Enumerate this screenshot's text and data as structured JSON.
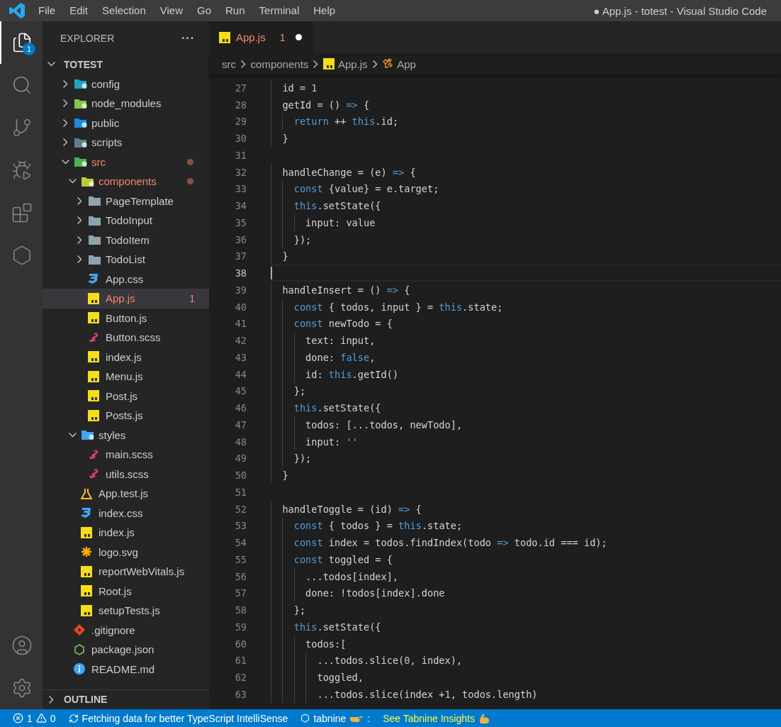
{
  "title_bar": {
    "menu": [
      "File",
      "Edit",
      "Selection",
      "View",
      "Go",
      "Run",
      "Terminal",
      "Help"
    ],
    "title": "● App.js - totest - Visual Studio Code"
  },
  "activity_bar": {
    "items": [
      {
        "kind": "explorer",
        "selected": true,
        "badge": "1"
      },
      {
        "kind": "search",
        "selected": false
      },
      {
        "kind": "source-control",
        "selected": false
      },
      {
        "kind": "run",
        "selected": false
      },
      {
        "kind": "extensions",
        "selected": false
      },
      {
        "kind": "remote",
        "selected": false
      }
    ],
    "bottom": [
      {
        "kind": "account"
      },
      {
        "kind": "settings"
      }
    ]
  },
  "sidebar": {
    "title": "EXPLORER",
    "more": "···",
    "section": {
      "title": "TOTEST",
      "expanded": true
    },
    "tree": [
      {
        "name": "config",
        "kind": "folder-config",
        "expanded": false,
        "selected": false,
        "problem": false
      },
      {
        "name": "node_modules",
        "kind": "folder-node",
        "expanded": false,
        "selected": false,
        "problem": false
      },
      {
        "name": "public",
        "kind": "folder-public",
        "expanded": false,
        "selected": false,
        "problem": false
      },
      {
        "name": "scripts",
        "kind": "folder-scripts",
        "expanded": false,
        "selected": false,
        "problem": false
      },
      {
        "name": "src",
        "kind": "folder-src",
        "expanded": true,
        "selected": false,
        "problem": true,
        "children": [
          {
            "name": "components",
            "kind": "folder-components",
            "expanded": true,
            "selected": false,
            "problem": true,
            "children": [
              {
                "name": "PageTemplate",
                "kind": "folder",
                "expanded": false,
                "selected": false,
                "problem": false
              },
              {
                "name": "TodoInput",
                "kind": "folder",
                "expanded": false,
                "selected": false,
                "problem": false
              },
              {
                "name": "TodoItem",
                "kind": "folder",
                "expanded": false,
                "selected": false,
                "problem": false
              },
              {
                "name": "TodoList",
                "kind": "folder",
                "expanded": false,
                "selected": false,
                "problem": false
              },
              {
                "name": "App.css",
                "kind": "css",
                "selected": false,
                "problem": false
              },
              {
                "name": "App.js",
                "kind": "js",
                "selected": true,
                "problem": true,
                "badge": "1"
              },
              {
                "name": "Button.js",
                "kind": "js",
                "selected": false,
                "problem": false
              },
              {
                "name": "Button.scss",
                "kind": "sass",
                "selected": false,
                "problem": false
              },
              {
                "name": "index.js",
                "kind": "js",
                "selected": false,
                "problem": false
              },
              {
                "name": "Menu.js",
                "kind": "js",
                "selected": false,
                "problem": false
              },
              {
                "name": "Post.js",
                "kind": "js",
                "selected": false,
                "problem": false
              },
              {
                "name": "Posts.js",
                "kind": "js",
                "selected": false,
                "problem": false
              }
            ]
          },
          {
            "name": "styles",
            "kind": "folder-styles",
            "expanded": true,
            "selected": false,
            "problem": false,
            "children": [
              {
                "name": "main.scss",
                "kind": "sass",
                "selected": false,
                "problem": false
              },
              {
                "name": "utils.scss",
                "kind": "sass",
                "selected": false,
                "problem": false
              }
            ]
          },
          {
            "name": "App.test.js",
            "kind": "test",
            "selected": false,
            "problem": false
          },
          {
            "name": "index.css",
            "kind": "css",
            "selected": false,
            "problem": false
          },
          {
            "name": "index.js",
            "kind": "js",
            "selected": false,
            "problem": false
          },
          {
            "name": "logo.svg",
            "kind": "svg",
            "selected": false,
            "problem": false
          },
          {
            "name": "reportWebVitals.js",
            "kind": "js",
            "selected": false,
            "problem": false
          },
          {
            "name": "Root.js",
            "kind": "js",
            "selected": false,
            "problem": false
          },
          {
            "name": "setupTests.js",
            "kind": "js",
            "selected": false,
            "problem": false
          }
        ]
      },
      {
        "name": ".gitignore",
        "kind": "git",
        "selected": false,
        "problem": false
      },
      {
        "name": "package.json",
        "kind": "node",
        "selected": false,
        "problem": false
      },
      {
        "name": "README.md",
        "kind": "info",
        "selected": false,
        "problem": false
      }
    ],
    "outline": {
      "title": "OUTLINE",
      "expanded": false
    }
  },
  "tabs": [
    {
      "label": "App.js",
      "kind": "js",
      "badge": "1",
      "problem": true,
      "dirty": true,
      "selected": true
    }
  ],
  "breadcrumbs": [
    {
      "label": "src",
      "kind": "folder"
    },
    {
      "label": "components",
      "kind": "folder"
    },
    {
      "label": "App.js",
      "kind": "js"
    },
    {
      "label": "App",
      "kind": "class"
    }
  ],
  "code": [
    {
      "n": "27",
      "current": false,
      "tokens": [
        {
          "t": "  id = ",
          "kind": "plain"
        },
        {
          "t": "1",
          "kind": "number"
        }
      ]
    },
    {
      "n": "28",
      "current": false,
      "tokens": [
        {
          "t": "  getId = () ",
          "kind": "plain"
        },
        {
          "t": "=>",
          "kind": "keyword"
        },
        {
          "t": " {",
          "kind": "plain"
        }
      ]
    },
    {
      "n": "29",
      "current": false,
      "tokens": [
        {
          "t": "    return",
          "kind": "keyword"
        },
        {
          "t": " ++ ",
          "kind": "plain"
        },
        {
          "t": "this",
          "kind": "keyword"
        },
        {
          "t": ".id;",
          "kind": "plain"
        }
      ]
    },
    {
      "n": "30",
      "current": false,
      "tokens": [
        {
          "t": "  }",
          "kind": "plain"
        }
      ]
    },
    {
      "n": "31",
      "current": false
    },
    {
      "n": "32",
      "current": false,
      "tokens": [
        {
          "t": "  handleChange = (e) ",
          "kind": "plain"
        },
        {
          "t": "=>",
          "kind": "keyword"
        },
        {
          "t": " {",
          "kind": "plain"
        }
      ]
    },
    {
      "n": "33",
      "current": false,
      "tokens": [
        {
          "t": "    const",
          "kind": "keyword"
        },
        {
          "t": " {value} = e.target;",
          "kind": "plain"
        }
      ]
    },
    {
      "n": "34",
      "current": false,
      "tokens": [
        {
          "t": "    this",
          "kind": "keyword"
        },
        {
          "t": ".setState({",
          "kind": "plain"
        }
      ]
    },
    {
      "n": "35",
      "current": false,
      "tokens": [
        {
          "t": "      input: value",
          "kind": "plain"
        }
      ]
    },
    {
      "n": "36",
      "current": false,
      "tokens": [
        {
          "t": "    });",
          "kind": "plain"
        }
      ]
    },
    {
      "n": "37",
      "current": false,
      "tokens": [
        {
          "t": "  }",
          "kind": "plain"
        }
      ]
    },
    {
      "n": "38",
      "current": true
    },
    {
      "n": "39",
      "current": false,
      "tokens": [
        {
          "t": "  handleInsert = () ",
          "kind": "plain"
        },
        {
          "t": "=>",
          "kind": "keyword"
        },
        {
          "t": " {",
          "kind": "plain"
        }
      ]
    },
    {
      "n": "40",
      "current": false,
      "tokens": [
        {
          "t": "    const",
          "kind": "keyword"
        },
        {
          "t": " { todos, input } = ",
          "kind": "plain"
        },
        {
          "t": "this",
          "kind": "keyword"
        },
        {
          "t": ".state;",
          "kind": "plain"
        }
      ]
    },
    {
      "n": "41",
      "current": false,
      "tokens": [
        {
          "t": "    const",
          "kind": "keyword"
        },
        {
          "t": " newTodo = {",
          "kind": "plain"
        }
      ]
    },
    {
      "n": "42",
      "current": false,
      "tokens": [
        {
          "t": "      text: input,",
          "kind": "plain"
        }
      ]
    },
    {
      "n": "43",
      "current": false,
      "tokens": [
        {
          "t": "      done: ",
          "kind": "plain"
        },
        {
          "t": "false",
          "kind": "keyword"
        },
        {
          "t": ",",
          "kind": "plain"
        }
      ]
    },
    {
      "n": "44",
      "current": false,
      "tokens": [
        {
          "t": "      id: ",
          "kind": "plain"
        },
        {
          "t": "this",
          "kind": "keyword"
        },
        {
          "t": ".getId()",
          "kind": "plain"
        }
      ]
    },
    {
      "n": "45",
      "current": false,
      "tokens": [
        {
          "t": "    };",
          "kind": "plain"
        }
      ]
    },
    {
      "n": "46",
      "current": false,
      "tokens": [
        {
          "t": "    this",
          "kind": "keyword"
        },
        {
          "t": ".setState({",
          "kind": "plain"
        }
      ]
    },
    {
      "n": "47",
      "current": false,
      "tokens": [
        {
          "t": "      todos: [...todos, newTodo],",
          "kind": "plain"
        }
      ]
    },
    {
      "n": "48",
      "current": false,
      "tokens": [
        {
          "t": "      input: ",
          "kind": "plain"
        },
        {
          "t": "''",
          "kind": "string"
        }
      ]
    },
    {
      "n": "49",
      "current": false,
      "tokens": [
        {
          "t": "    });",
          "kind": "plain"
        }
      ]
    },
    {
      "n": "50",
      "current": false,
      "tokens": [
        {
          "t": "  }",
          "kind": "plain"
        }
      ]
    },
    {
      "n": "51",
      "current": false
    },
    {
      "n": "52",
      "current": false,
      "tokens": [
        {
          "t": "  handleToggle = (id) ",
          "kind": "plain"
        },
        {
          "t": "=>",
          "kind": "keyword"
        },
        {
          "t": " {",
          "kind": "plain"
        }
      ]
    },
    {
      "n": "53",
      "current": false,
      "tokens": [
        {
          "t": "    const",
          "kind": "keyword"
        },
        {
          "t": " { todos } = ",
          "kind": "plain"
        },
        {
          "t": "this",
          "kind": "keyword"
        },
        {
          "t": ".state;",
          "kind": "plain"
        }
      ]
    },
    {
      "n": "54",
      "current": false,
      "tokens": [
        {
          "t": "    const",
          "kind": "keyword"
        },
        {
          "t": " index = todos.findIndex(todo ",
          "kind": "plain"
        },
        {
          "t": "=>",
          "kind": "keyword"
        },
        {
          "t": " todo.id === id);",
          "kind": "plain"
        }
      ]
    },
    {
      "n": "55",
      "current": false,
      "tokens": [
        {
          "t": "    const",
          "kind": "keyword"
        },
        {
          "t": " toggled = {",
          "kind": "plain"
        }
      ]
    },
    {
      "n": "56",
      "current": false,
      "tokens": [
        {
          "t": "      ...todos[index],",
          "kind": "plain"
        }
      ]
    },
    {
      "n": "57",
      "current": false,
      "tokens": [
        {
          "t": "      done: !todos[index].done",
          "kind": "plain"
        }
      ]
    },
    {
      "n": "58",
      "current": false,
      "tokens": [
        {
          "t": "    };",
          "kind": "plain"
        }
      ]
    },
    {
      "n": "59",
      "current": false,
      "tokens": [
        {
          "t": "    this",
          "kind": "keyword"
        },
        {
          "t": ".setState({",
          "kind": "plain"
        }
      ]
    },
    {
      "n": "60",
      "current": false,
      "tokens": [
        {
          "t": "      todos:[",
          "kind": "plain"
        }
      ]
    },
    {
      "n": "61",
      "current": false,
      "tokens": [
        {
          "t": "        ...todos.slice(",
          "kind": "plain"
        },
        {
          "t": "0",
          "kind": "number"
        },
        {
          "t": ", index),",
          "kind": "plain"
        }
      ]
    },
    {
      "n": "62",
      "current": false,
      "tokens": [
        {
          "t": "        toggled,",
          "kind": "plain"
        }
      ]
    },
    {
      "n": "63",
      "current": false,
      "tokens": [
        {
          "t": "        ...todos.slice(index +",
          "kind": "plain"
        },
        {
          "t": "1",
          "kind": "number"
        },
        {
          "t": ", todos.length)",
          "kind": "plain"
        }
      ]
    }
  ],
  "status_bar": {
    "errors": "1",
    "warnings": "0",
    "sync_message": "Fetching data for better TypeScript IntelliSense",
    "tabnine_label": "tabnine",
    "tabnine_suffix": ":",
    "insights": "See Tabnine Insights"
  }
}
